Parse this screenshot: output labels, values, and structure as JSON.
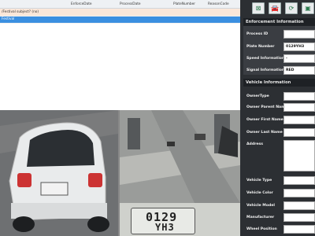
{
  "grid": {
    "columns": [
      "",
      "EnforceDate",
      "ProcessDate",
      "PlateNumber",
      "ReasonCode"
    ],
    "selected_row": 1,
    "rows": [
      [
        "/Festival subject? (no)",
        "",
        "",
        "",
        ""
      ],
      [
        "Festival ",
        "",
        "",
        "",
        ""
      ]
    ]
  },
  "toolbar": {
    "btn1": "⊠",
    "btn2": "🚘",
    "btn3": "⟳",
    "btn4": "▣"
  },
  "enforcement": {
    "title": "Enforcement Information",
    "process_id_label": "Process ID",
    "process_id_value": "",
    "plate_label": "Plate Number",
    "plate_value": "0129YH3",
    "speed_label": "Speed Information",
    "speed_value": "-",
    "signal_label": "Signal Information",
    "signal_value": "RED"
  },
  "vehicle": {
    "title": "Vehicle Information",
    "owner_type": "OwnerType",
    "owner_parent": "Owner Parent Name",
    "owner_first": "Owner First Name",
    "owner_last": "Owner Last Name",
    "address": "Address",
    "vehicle_type": "Vehicle Type",
    "vehicle_color": "Vehicle Color",
    "vehicle_model": "Vehicle Model",
    "manufacturer": "Manufacturer",
    "wheel_position": "Wheel Position"
  },
  "plate_image": {
    "line1": "0129",
    "line2": "YH3"
  }
}
